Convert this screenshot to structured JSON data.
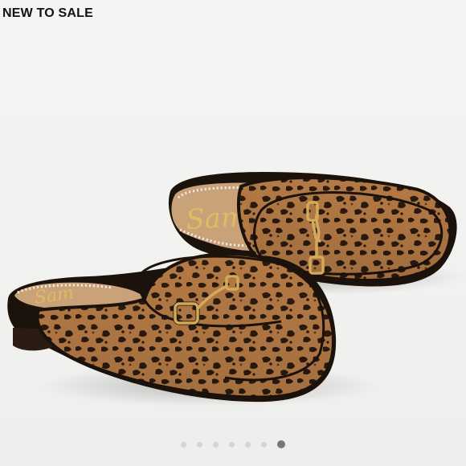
{
  "listing": {
    "badge": "NEW TO SALE"
  },
  "photo": {
    "subject": "leopard-print-loafer-mules",
    "insole_logo_back": "Sam",
    "insole_logo_front": "Sam",
    "background_color": "#f2f2f0",
    "print_base_color": "#b47a45",
    "spot_color": "#2a1a10",
    "hardware_color": "#d2aa5a",
    "insole_color": "#c9a27a"
  },
  "carousel": {
    "total": 7,
    "active_index": 6,
    "dots": [
      {
        "label": "Photo 1"
      },
      {
        "label": "Photo 2"
      },
      {
        "label": "Photo 3"
      },
      {
        "label": "Photo 4"
      },
      {
        "label": "Photo 5"
      },
      {
        "label": "Photo 6"
      },
      {
        "label": "Photo 7"
      }
    ]
  }
}
